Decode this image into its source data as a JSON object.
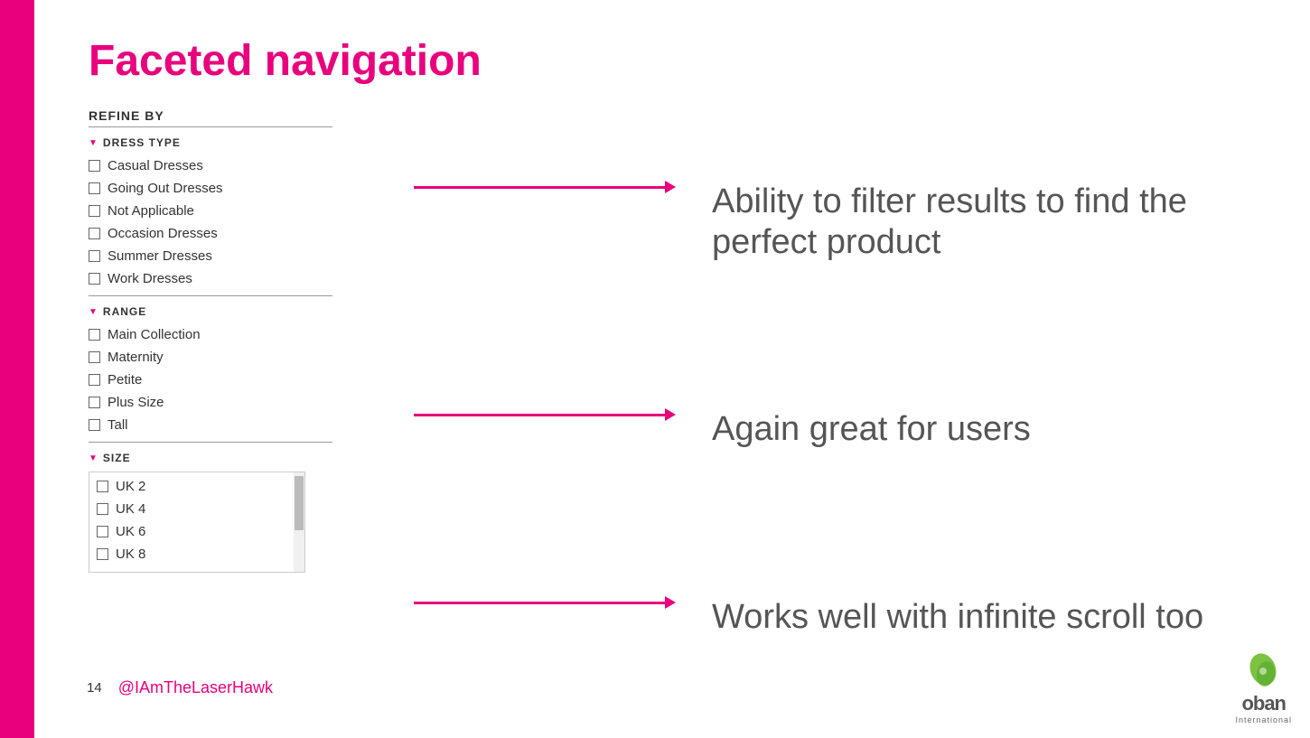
{
  "slide": {
    "title": "Faceted navigation",
    "refine_label": "REFINE BY",
    "sections": [
      {
        "name": "dress-type",
        "label": "DRESS TYPE",
        "items": [
          "Casual Dresses",
          "Going Out Dresses",
          "Not Applicable",
          "Occasion Dresses",
          "Summer Dresses",
          "Work Dresses"
        ]
      },
      {
        "name": "range",
        "label": "RANGE",
        "items": [
          "Main Collection",
          "Maternity",
          "Petite",
          "Plus Size",
          "Tall"
        ]
      },
      {
        "name": "size",
        "label": "SIZE",
        "items": [
          "UK 2",
          "UK 4",
          "UK 6",
          "UK 8"
        ]
      }
    ],
    "annotations": [
      "Ability to filter results to find the perfect product",
      "Again great for users",
      "Works well with infinite scroll too"
    ],
    "page_number": "14",
    "twitter": "@IAmTheLaserHawk",
    "oban_text": "oban",
    "oban_sub": "International"
  }
}
